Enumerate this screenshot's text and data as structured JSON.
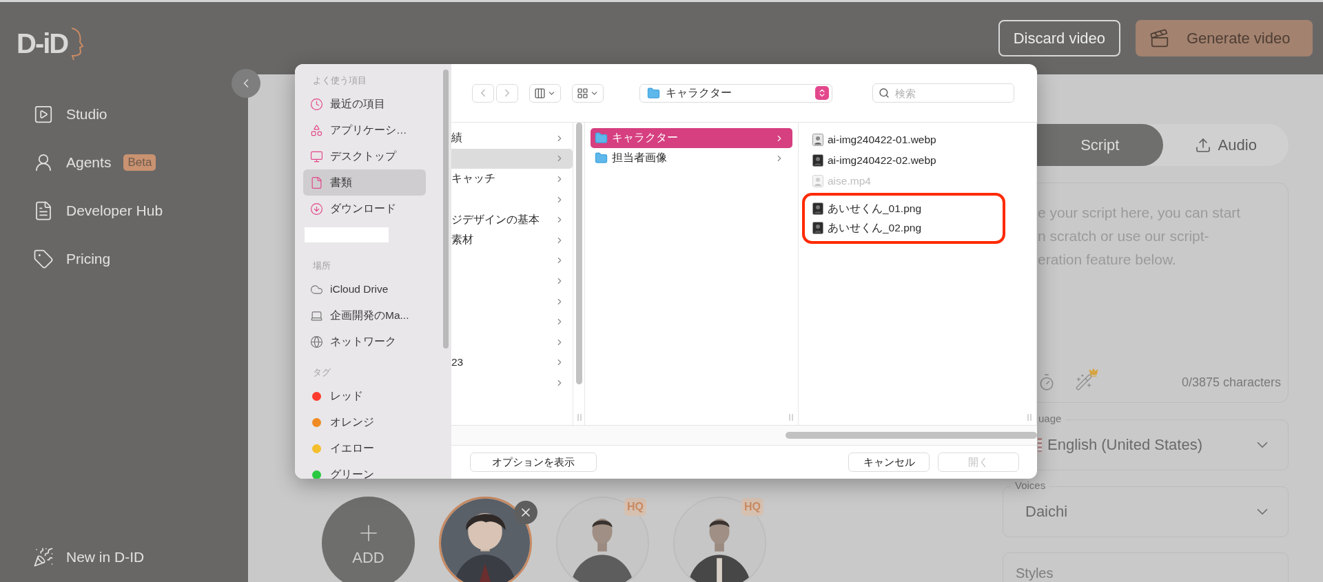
{
  "logo": {
    "text": "D-iD"
  },
  "nav": [
    {
      "label": "Studio"
    },
    {
      "label": "Agents",
      "badge": "Beta"
    },
    {
      "label": "Developer Hub"
    },
    {
      "label": "Pricing"
    }
  ],
  "nav_footer": {
    "label": "New in D-ID"
  },
  "header": {
    "buttons": [
      {
        "label": "Discard video",
        "kind": "outline"
      },
      {
        "label": "Generate video",
        "kind": "primary"
      }
    ]
  },
  "avatars": [
    {
      "kind": "add",
      "label": "ADD"
    },
    {
      "kind": "avatar",
      "selected": true,
      "removable": true
    },
    {
      "kind": "avatar",
      "selected": false,
      "badge": "HQ"
    },
    {
      "kind": "avatar",
      "selected": false,
      "badge": "HQ"
    }
  ],
  "panel": {
    "tabs": [
      {
        "label": "Script",
        "selected": true
      },
      {
        "label": "Audio",
        "selected": false
      }
    ],
    "script_placeholder_lines": [
      "e your script here, you can start",
      "n scratch or use our script-",
      "eration feature below."
    ],
    "char_count": "0/3875 characters",
    "language": {
      "label": "uage",
      "value": "English (United States)"
    },
    "voices": {
      "label": "Voices",
      "value": "Daichi"
    },
    "styles": {
      "label": "Styles"
    }
  },
  "dialog": {
    "sidebar": [
      {
        "heading": "よく使う項目",
        "items": [
          {
            "label": "最近の項目",
            "selected": false
          },
          {
            "label": "アプリケーシ…",
            "selected": false
          },
          {
            "label": "デスクトップ",
            "selected": false
          },
          {
            "label": "書類",
            "selected": true
          },
          {
            "label": "ダウンロード",
            "selected": false
          },
          {
            "kind": "redacted",
            "selected": false
          }
        ]
      },
      {
        "heading": "場所",
        "items": [
          {
            "label": "iCloud Drive",
            "selected": false
          },
          {
            "label": "企画開発のMa...",
            "selected": false
          },
          {
            "label": "ネットワーク",
            "selected": false
          }
        ]
      },
      {
        "heading": "タグ",
        "items": [
          {
            "label": "レッド",
            "color": "#ff3b30",
            "selected": false
          },
          {
            "label": "オレンジ",
            "color": "#f08a24",
            "selected": false
          },
          {
            "label": "イエロー",
            "color": "#f5be2d",
            "selected": false
          },
          {
            "label": "グリーン",
            "color": "#2ac840",
            "selected": false
          }
        ]
      }
    ],
    "path": "キャラクター",
    "search": {
      "placeholder": "検索"
    },
    "column_1": [
      {
        "label": "績",
        "selected": false
      },
      {
        "selected": true
      },
      {
        "label": "キャッチ",
        "selected": false
      },
      {
        "selected": false
      },
      {
        "label": "ジデザインの基本",
        "selected": false
      },
      {
        "label": "素材",
        "selected": false
      },
      {
        "selected": false
      },
      {
        "selected": false
      },
      {
        "selected": false
      },
      {
        "selected": false
      },
      {
        "selected": false
      },
      {
        "label": "23",
        "selected": false
      },
      {
        "selected": false
      }
    ],
    "column_2": [
      {
        "label": "キャラクター",
        "selected": true
      },
      {
        "label": "担当者画像",
        "selected": false
      }
    ],
    "column_3": [
      {
        "label": "ai-img240422-01.webp",
        "disabled": false,
        "highlighted": false
      },
      {
        "label": "ai-img240422-02.webp",
        "disabled": false,
        "highlighted": false
      },
      {
        "label": "aise.mp4",
        "disabled": true,
        "highlighted": false
      },
      {
        "label": "あいせくん_01.png",
        "disabled": false,
        "highlighted": true
      },
      {
        "label": "あいせくん_02.png",
        "disabled": false,
        "highlighted": true
      }
    ],
    "buttons": [
      {
        "label": "オプションを表示",
        "disabled": false
      },
      {
        "label": "キャンセル",
        "disabled": false
      },
      {
        "label": "開く",
        "disabled": true
      }
    ]
  }
}
